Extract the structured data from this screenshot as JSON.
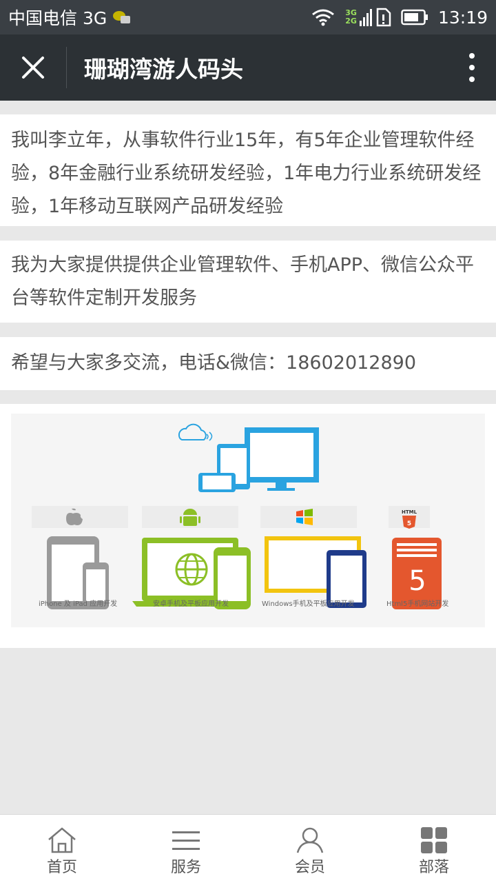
{
  "status_bar": {
    "carrier": "中国电信 3G",
    "network_badge_top": "3G",
    "network_badge_bottom": "2G",
    "time": "13:19"
  },
  "title_bar": {
    "title": "珊瑚湾游人码头"
  },
  "content": {
    "paragraphs": [
      "我叫李立年，从事软件行业15年，有5年企业管理软件经验，8年金融行业系统研发经验，1年电力行业系统研发经验，1年移动互联网产品研发经验",
      "我为大家提供提供企业管理软件、手机APP、微信公众平台等软件定制开发服务",
      "希望与大家多交流，电话&微信：18602012890"
    ],
    "banner": {
      "html5_badge": "HTML",
      "html5_digit": "5",
      "captions": [
        "iPhone 及 iPad 应用开发",
        "安卓手机及平板应用开发",
        "Windows手机及平板应用开发",
        "Html5手机网站开发"
      ]
    }
  },
  "tab_bar": {
    "tabs": [
      {
        "label": "首页",
        "icon": "home-icon"
      },
      {
        "label": "服务",
        "icon": "list-icon"
      },
      {
        "label": "会员",
        "icon": "user-icon"
      },
      {
        "label": "部落",
        "icon": "grid-icon"
      }
    ]
  },
  "colors": {
    "title_bar_bg": "#2c3135",
    "status_bar_bg": "#3a3f44",
    "page_bg": "#e8e8e8",
    "device_blue": "#2aa3e0",
    "android_green": "#8cbf26",
    "windows_yellow": "#f2c40f",
    "html5_orange": "#e4572e"
  }
}
